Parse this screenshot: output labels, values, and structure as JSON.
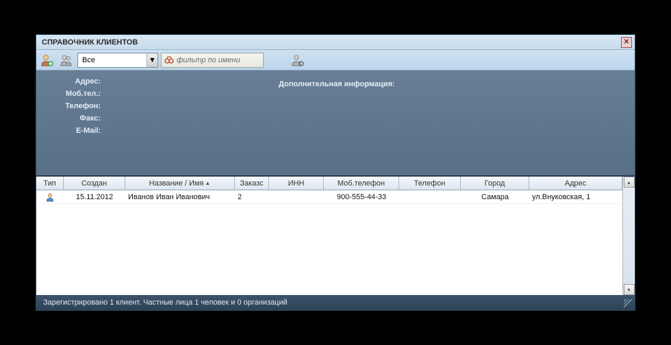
{
  "window": {
    "title": "СПРАВОЧНИК КЛИЕНТОВ"
  },
  "toolbar": {
    "filter_select": "Все",
    "name_filter_placeholder": "фильтр по имени"
  },
  "detail": {
    "labels": {
      "address": "Адрес:",
      "mobile": "Моб.тел.:",
      "phone": "Телефон:",
      "fax": "Факс:",
      "email": "E-Mail:"
    },
    "extra_title": "Дополнительная информация:"
  },
  "grid": {
    "columns": {
      "type": "Тип",
      "created": "Создан",
      "name": "Название / Имя",
      "orders": "Заказс",
      "inn": "ИНН",
      "mobile": "Моб.телефон",
      "phone": "Телефон",
      "city": "Город",
      "address": "Адрес"
    },
    "rows": [
      {
        "type": "person",
        "created": "15.11.2012",
        "name": "Иванов Иван Иванович",
        "orders": "2",
        "inn": "",
        "mobile": "900-555-44-33",
        "phone": "",
        "city": "Самара",
        "address": "ул.Внуковская, 1"
      }
    ]
  },
  "status": "Зарегистрировано 1 клиент. Частные лица 1 человек и 0 организаций"
}
